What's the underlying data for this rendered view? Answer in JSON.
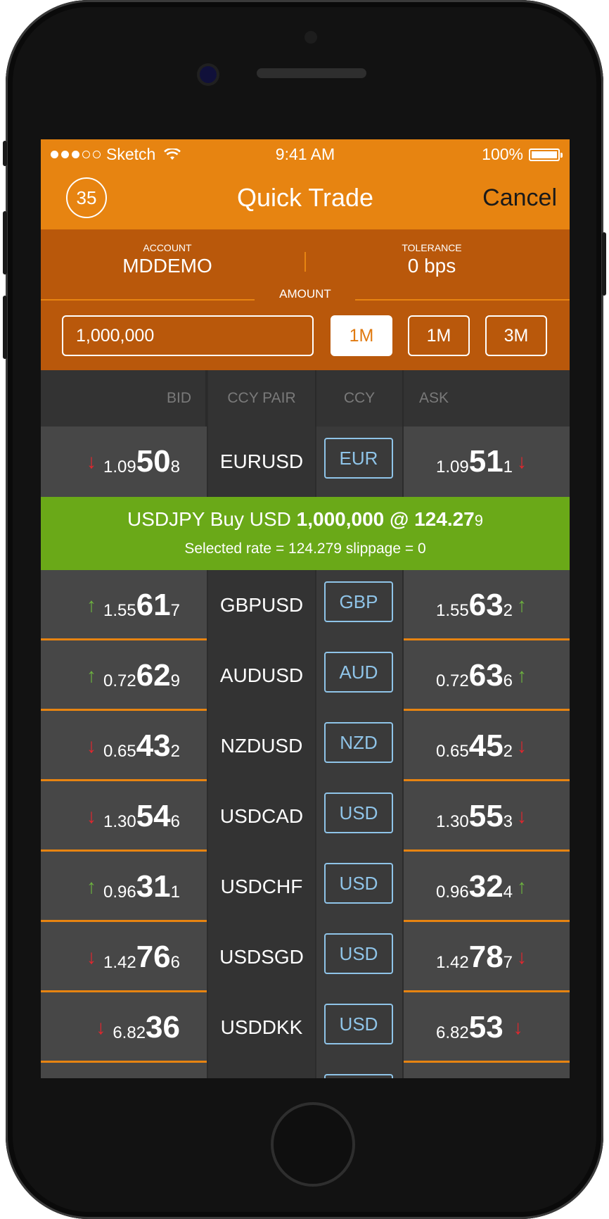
{
  "status_bar": {
    "carrier": "Sketch",
    "time": "9:41 AM",
    "battery": "100%"
  },
  "nav": {
    "counter": "35",
    "title": "Quick Trade",
    "cancel": "Cancel"
  },
  "form": {
    "account_label": "ACCOUNT",
    "account_value": "MDDEMO",
    "tolerance_label": "TOLERANCE",
    "tolerance_value": "0 bps",
    "amount_label": "AMOUNT",
    "amount_value": "1,000,000",
    "tenor_buttons": [
      "1M",
      "1M",
      "3M"
    ],
    "selected_tenor_index": 0
  },
  "columns": {
    "bid": "BID",
    "pair": "CCY PAIR",
    "ccy": "CCY",
    "ask": "ASK"
  },
  "colors": {
    "accent": "#e78411",
    "panel": "#b9580b",
    "up": "#6db33f",
    "down": "#e4262d",
    "confirm": "#6aa918",
    "ccy_border": "#8fc4e8"
  },
  "rows": [
    {
      "pair": "EURUSD",
      "ccy": "EUR",
      "bid_dir": "down",
      "bid_small": "1.09",
      "bid_big": "50",
      "bid_pip": "8",
      "ask_dir": "down",
      "ask_small": "1.09",
      "ask_big": "51",
      "ask_pip": "1"
    },
    {
      "pair": "GBPUSD",
      "ccy": "GBP",
      "bid_dir": "up",
      "bid_small": "1.55",
      "bid_big": "61",
      "bid_pip": "7",
      "ask_dir": "up",
      "ask_small": "1.55",
      "ask_big": "63",
      "ask_pip": "2"
    },
    {
      "pair": "AUDUSD",
      "ccy": "AUD",
      "bid_dir": "up",
      "bid_small": "0.72",
      "bid_big": "62",
      "bid_pip": "9",
      "ask_dir": "up",
      "ask_small": "0.72",
      "ask_big": "63",
      "ask_pip": "6"
    },
    {
      "pair": "NZDUSD",
      "ccy": "NZD",
      "bid_dir": "down",
      "bid_small": "0.65",
      "bid_big": "43",
      "bid_pip": "2",
      "ask_dir": "down",
      "ask_small": "0.65",
      "ask_big": "45",
      "ask_pip": "2"
    },
    {
      "pair": "USDCAD",
      "ccy": "USD",
      "bid_dir": "down",
      "bid_small": "1.30",
      "bid_big": "54",
      "bid_pip": "6",
      "ask_dir": "down",
      "ask_small": "1.30",
      "ask_big": "55",
      "ask_pip": "3"
    },
    {
      "pair": "USDCHF",
      "ccy": "USD",
      "bid_dir": "up",
      "bid_small": "0.96",
      "bid_big": "31",
      "bid_pip": "1",
      "ask_dir": "up",
      "ask_small": "0.96",
      "ask_big": "32",
      "ask_pip": "4"
    },
    {
      "pair": "USDSGD",
      "ccy": "USD",
      "bid_dir": "down",
      "bid_small": "1.42",
      "bid_big": "76",
      "bid_pip": "6",
      "ask_dir": "down",
      "ask_small": "1.42",
      "ask_big": "78",
      "ask_pip": "7"
    },
    {
      "pair": "USDDKK",
      "ccy": "USD",
      "bid_dir": "down",
      "bid_small": "6.82",
      "bid_big": "36",
      "bid_pip": "",
      "ask_dir": "down",
      "ask_small": "6.82",
      "ask_big": "53",
      "ask_pip": ""
    }
  ],
  "confirmation": {
    "prefix": "USDJPY Buy USD ",
    "amount": "1,000,000",
    "at": " @ ",
    "rate_main": "124.27",
    "rate_pip": "9",
    "detail": "Selected rate = 124.279  slippage = 0"
  }
}
